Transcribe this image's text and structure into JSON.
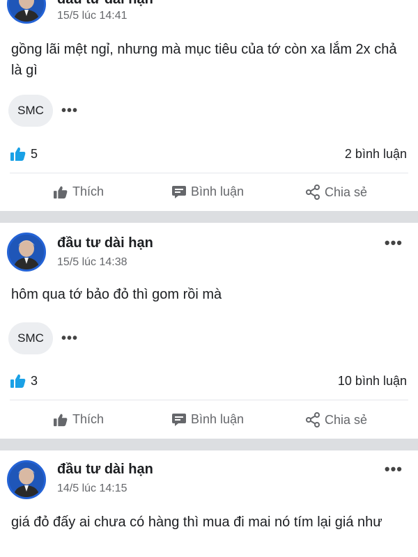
{
  "posts": [
    {
      "author": "đầu tư dài hạn",
      "time": "15/5 lúc 14:41",
      "content": "gồng lãi mệt ngỉ, nhưng mà mục tiêu của tớ còn xa lắm 2x chả là gì",
      "tag": "SMC",
      "likes": "5",
      "comments": "2 bình luận"
    },
    {
      "author": "đầu tư dài hạn",
      "time": "15/5 lúc 14:38",
      "content": "hôm qua tớ bảo đỏ thì gom rồi mà",
      "tag": "SMC",
      "likes": "3",
      "comments": "10 bình luận"
    },
    {
      "author": "đầu tư dài hạn",
      "time": "14/5 lúc 14:15",
      "content": "giá đỏ đấy ai chưa có hàng thì mua đi mai nó tím lại giá như"
    }
  ],
  "actions": {
    "like": "Thích",
    "comment": "Bình luận",
    "share": "Chia sẻ"
  },
  "icons": {
    "more": "more-horizontal-icon",
    "like_reaction": "thumbs-up-icon",
    "comment": "comment-icon",
    "share": "share-icon"
  },
  "colors": {
    "accent": "#1877f2",
    "muted": "#65676b",
    "separator": "#dcdee1"
  }
}
